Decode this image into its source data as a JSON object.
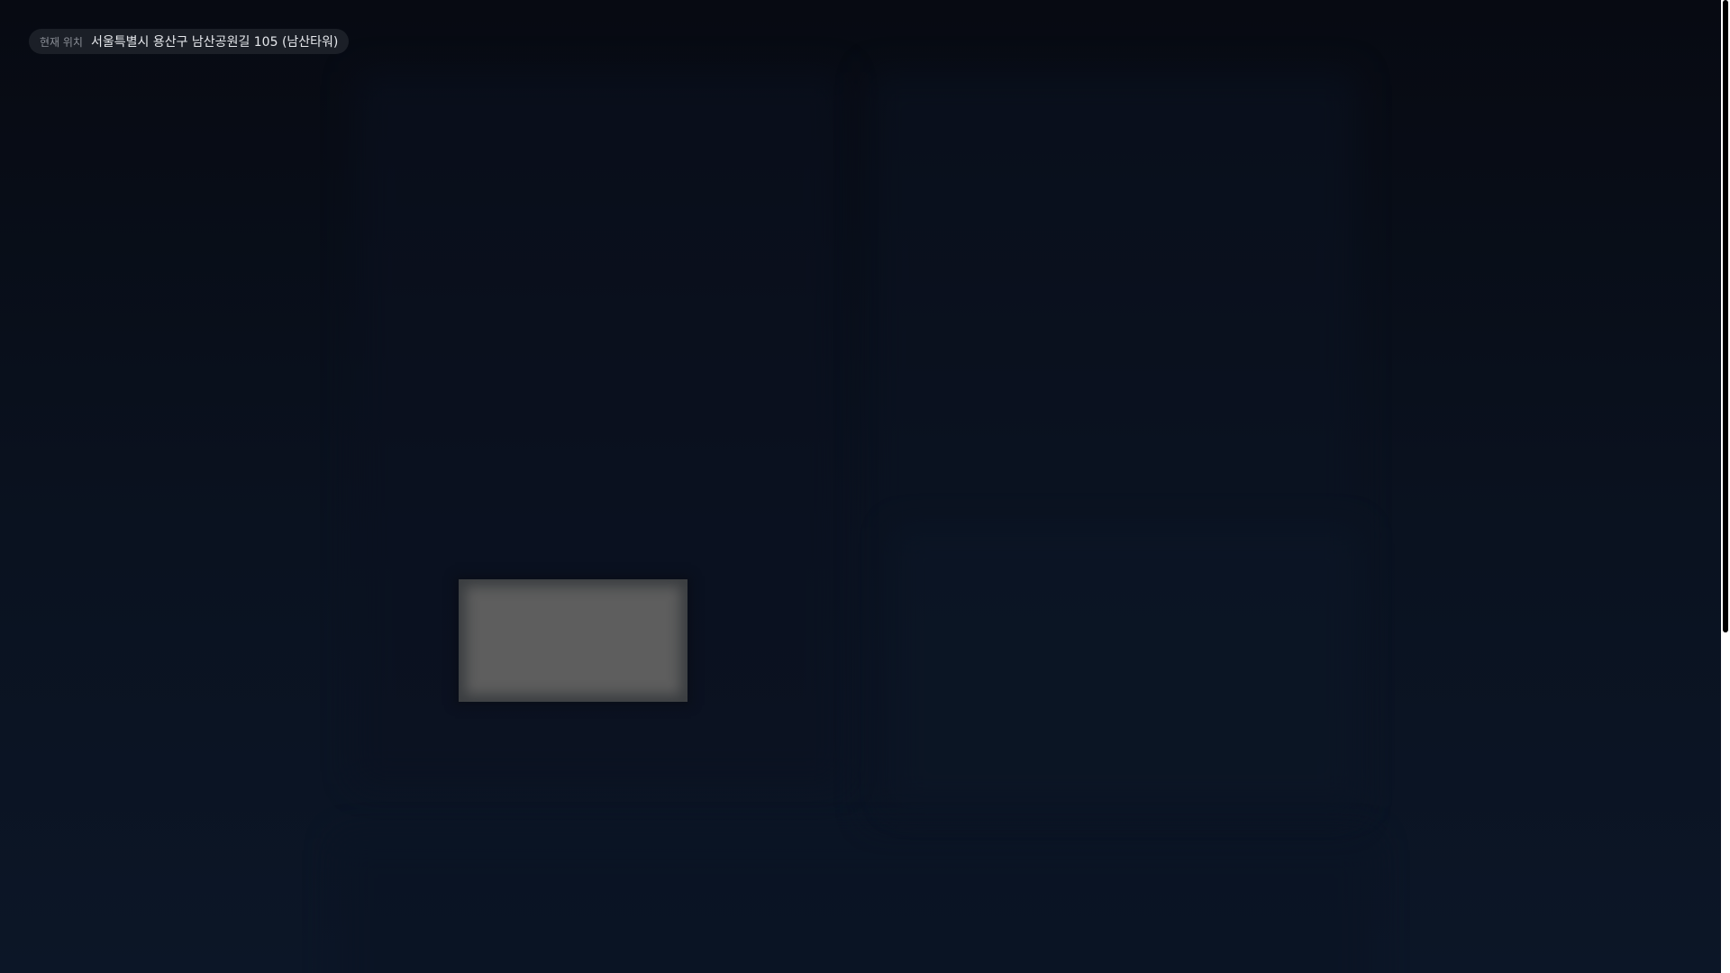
{
  "location": {
    "label": "현재 위치",
    "address": "서울특별시 용산구 남산공원길 105 (남산타워)"
  },
  "colors": {
    "background": "#080c16",
    "pill_background": "#1b1f27",
    "placeholder": "#5e5e5e"
  },
  "scroll": {
    "thumb_fraction": 0.65
  }
}
